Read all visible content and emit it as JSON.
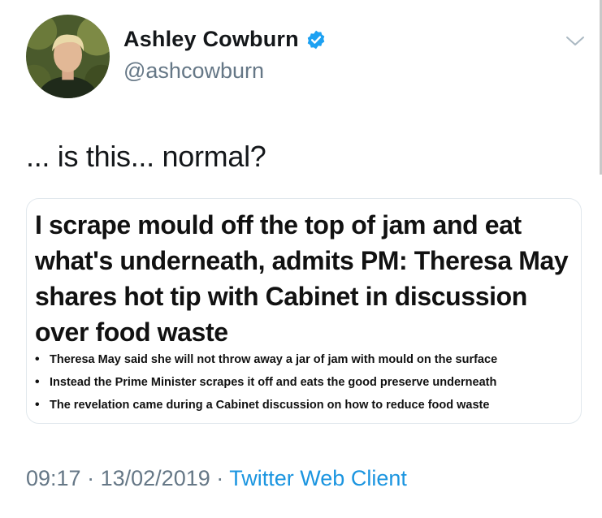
{
  "author": {
    "name": "Ashley Cowburn",
    "handle": "@ashcowburn",
    "verified": true
  },
  "tweet": {
    "text": "... is this... normal?"
  },
  "card": {
    "headline": "I scrape mould off the top of jam and eat what's underneath, admits PM: Theresa May shares hot tip with Cabinet in discussion over food waste",
    "bullets": [
      "Theresa May said she will not throw away a jar of jam with mould on the surface",
      "Instead the Prime Minister scrapes it off and eats the good preserve underneath",
      "The revelation came during a Cabinet discussion on how to reduce food waste"
    ]
  },
  "meta": {
    "time": "09:17",
    "separator": "·",
    "date": "13/02/2019",
    "source": "Twitter Web Client"
  },
  "icons": {
    "verified": "verified-badge-icon",
    "more": "chevron-down-icon"
  },
  "colors": {
    "text": "#14171a",
    "secondary": "#657786",
    "link": "#1b95e0",
    "card_border": "#e1e8ed"
  }
}
